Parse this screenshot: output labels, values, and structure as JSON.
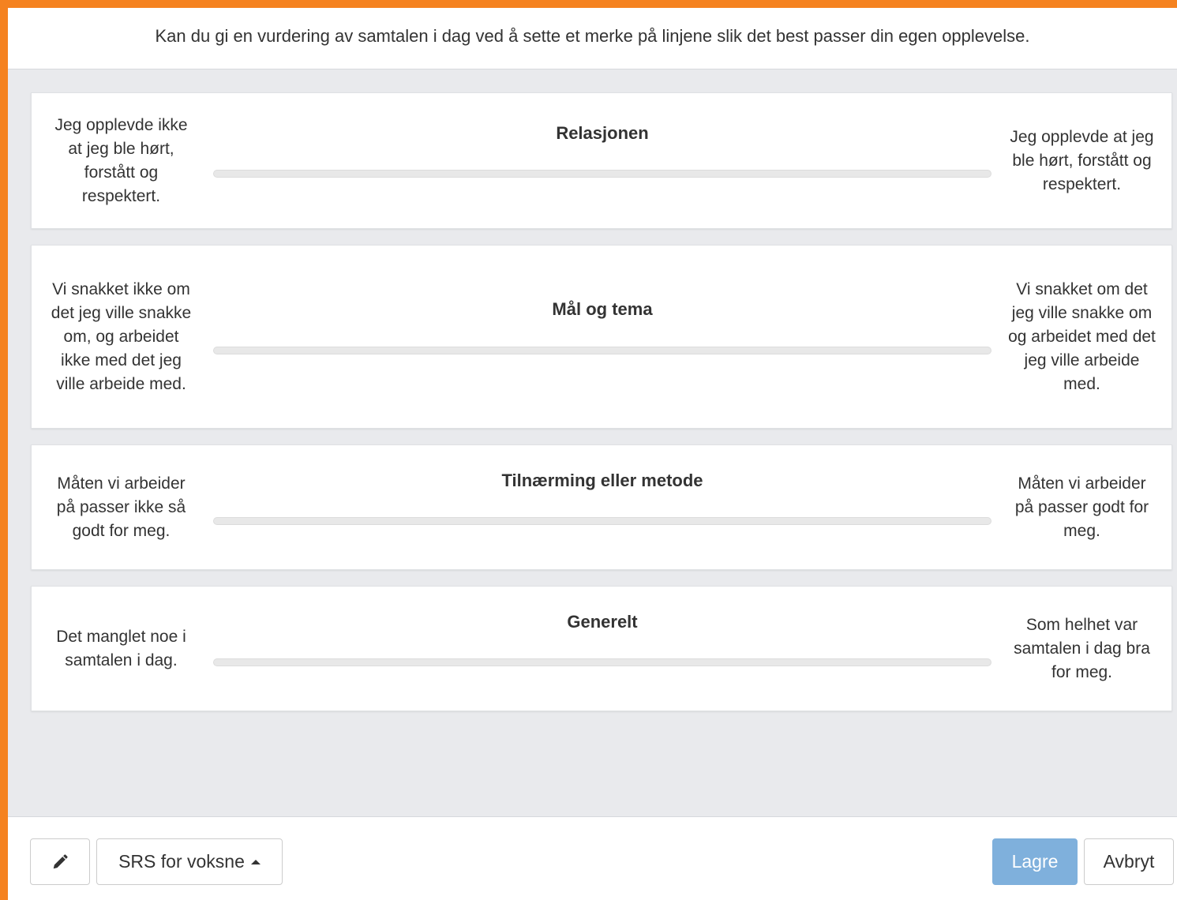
{
  "intro": "Kan du gi en vurdering av samtalen i dag ved å sette et merke på linjene slik det best passer din egen opplevelse.",
  "scales": [
    {
      "title": "Relasjonen",
      "left": "Jeg opplevde ikke at jeg ble hørt, forstått og respektert.",
      "right": "Jeg opplevde at jeg ble hørt, forstått og respektert."
    },
    {
      "title": "Mål og tema",
      "left": "Vi snakket ikke om det jeg ville snakke om, og arbeidet ikke med det jeg ville arbeide med.",
      "right": "Vi snakket om det jeg ville snakke om og arbeidet med det jeg ville arbeide med."
    },
    {
      "title": "Tilnærming eller metode",
      "left": "Måten vi arbeider på passer ikke så godt for meg.",
      "right": "Måten vi arbeider på passer godt for meg."
    },
    {
      "title": "Generelt",
      "left": "Det manglet noe i samtalen i dag.",
      "right": "Som helhet var samtalen i dag bra for meg."
    }
  ],
  "footer": {
    "edit_icon": "pencil-icon",
    "form_selector": "SRS for voksne",
    "save": "Lagre",
    "cancel": "Avbryt"
  },
  "colors": {
    "frame": "#f5821f",
    "background": "#e9eaed",
    "primary_button": "#7fb0dc"
  }
}
